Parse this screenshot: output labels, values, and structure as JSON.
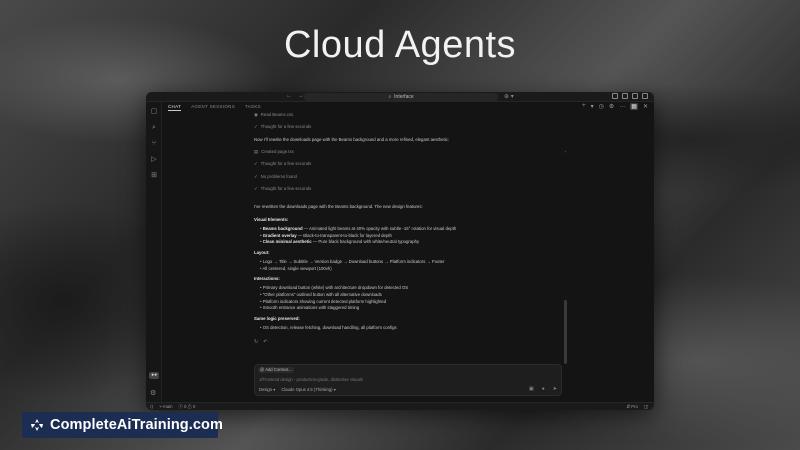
{
  "hero": {
    "title": "Cloud Agents"
  },
  "window": {
    "search_text": "Interface",
    "tabs": [
      "CHAT",
      "AGENT SESSIONS",
      "TASKS"
    ],
    "chat": {
      "read_step": "Read  Beams.css",
      "thought1": "Thought for a few seconds",
      "intro": "Now I'll rewrite the downloads page with the Beams background and a more refined, elegant aesthetic:",
      "created": "Created  page.tsx",
      "thought2": "Thought for a few seconds",
      "no_problems": "No problems found",
      "thought3": "Thought for a few seconds",
      "summary": "I've rewritten the downloads page with the Beams background. The new design features:",
      "visual_title": "Visual Elements:",
      "visual_items": [
        {
          "bold": "Beams background",
          "text": " — Animated light beams at 40% opacity with subtle -15° rotation for visual depth"
        },
        {
          "bold": "Gradient overlay",
          "text": " — Black-to-transparent-to-black for layered depth"
        },
        {
          "bold": "Clean minimal aesthetic",
          "text": " — Pure black background with white/neutral typography"
        }
      ],
      "layout_title": "Layout:",
      "layout_items": [
        "Logo → Title → Subtitle → Version badge → Download buttons → Platform indicators → Footer",
        "All centered, single viewport (100vh)"
      ],
      "interactions_title": "Interactions:",
      "interaction_items": [
        "Primary download button (white) with architecture dropdown for detected OS",
        "\"Other platforms\" outlined button with all alternative downloads",
        "Platform indicators showing current detected platform highlighted",
        "Smooth entrance animations with staggered timing"
      ],
      "logic_title": "Same logic preserved:",
      "logic_items": [
        "OS detection, release fetching, download handling, all platform configs"
      ]
    },
    "composer": {
      "add_context": "Add Context...",
      "placeholder": "1/Frontend design - production-grade, distinctive visuals",
      "mode": "Design",
      "model": "Claude Opus 4.5 (Thinking)"
    },
    "status": {
      "branch": "main",
      "errors": "0",
      "warnings": "0",
      "plan": "Pro"
    }
  },
  "brand": {
    "name": "CompleteAiTraining.com"
  }
}
